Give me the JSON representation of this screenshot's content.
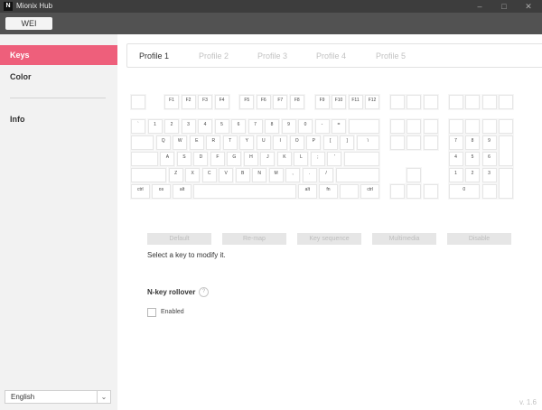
{
  "window": {
    "title": "Mionix Hub",
    "logo": "N"
  },
  "toolbar": {
    "device": "WEI"
  },
  "sidebar": {
    "items": [
      {
        "label": "Keys"
      },
      {
        "label": "Color"
      },
      {
        "label": "Info"
      }
    ],
    "language": "English",
    "language_arrow": "chevron-down-icon"
  },
  "tabs": [
    "Profile 1",
    "Profile 2",
    "Profile 3",
    "Profile 4",
    "Profile 5"
  ],
  "keyboard": {
    "rows": [
      [
        "",
        "F1",
        "F2",
        "F3",
        "F4",
        "F5",
        "F6",
        "F7",
        "F8",
        "F9",
        "F10",
        "F11",
        "F12",
        "",
        "",
        "",
        "",
        "",
        "",
        ""
      ],
      [
        "`",
        "1",
        "2",
        "3",
        "4",
        "5",
        "6",
        "7",
        "8",
        "9",
        "0",
        "-",
        "=",
        "",
        "",
        "",
        "",
        "",
        "",
        "",
        ""
      ],
      [
        "",
        "Q",
        "W",
        "E",
        "R",
        "T",
        "Y",
        "U",
        "I",
        "O",
        "P",
        "[",
        "]",
        "\\",
        "",
        "",
        "",
        "7",
        "8",
        "9",
        ""
      ],
      [
        "",
        "A",
        "S",
        "D",
        "F",
        "G",
        "H",
        "J",
        "K",
        "L",
        ";",
        "'",
        "",
        "4",
        "5",
        "6"
      ],
      [
        "",
        "Z",
        "X",
        "C",
        "V",
        "B",
        "N",
        "M",
        ",",
        ".",
        "/",
        "",
        "",
        "1",
        "2",
        "3",
        ""
      ],
      [
        "ctrl",
        "os",
        "alt",
        "",
        "alt",
        "fn",
        "",
        "ctrl",
        "",
        "",
        "",
        "0",
        ""
      ]
    ]
  },
  "actions": [
    "Default",
    "Re-map",
    "Key sequence",
    "Multimedia",
    "Disable"
  ],
  "hint": "Select a key to modify it.",
  "nkro": {
    "title": "N-key rollover",
    "help": "?",
    "label": "Enabled",
    "checked": false
  },
  "version": "v. 1.6"
}
